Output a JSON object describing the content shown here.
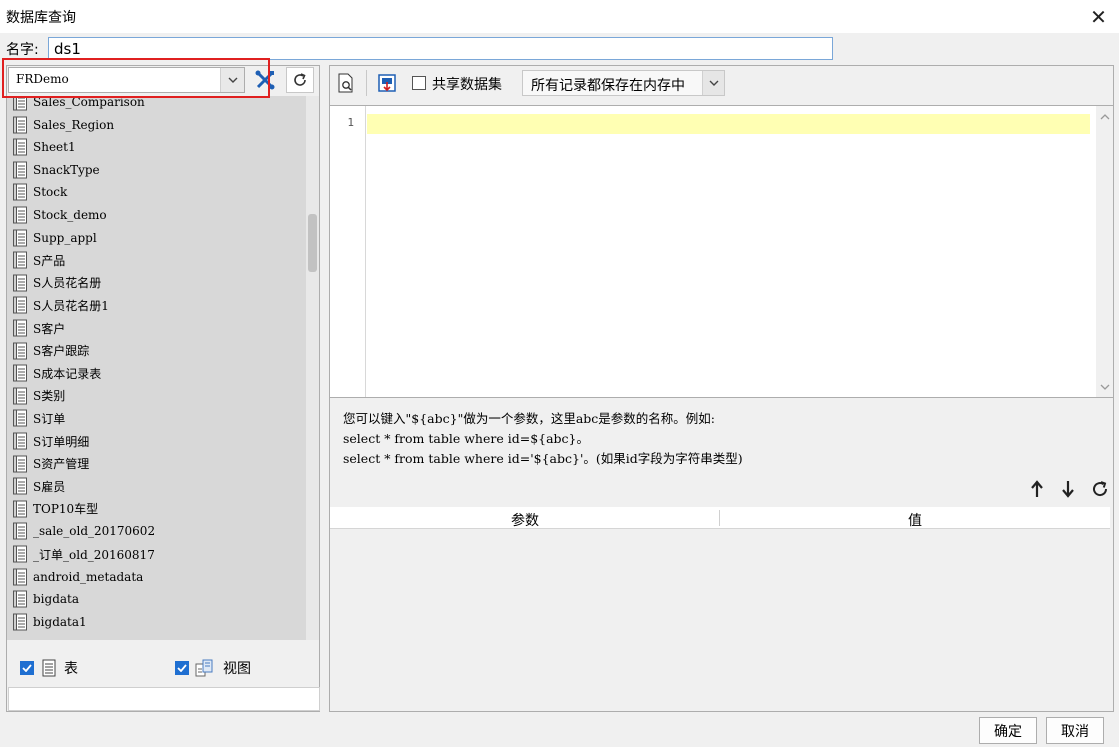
{
  "window": {
    "title": "数据库查询",
    "close_glyph": "✕"
  },
  "name_field": {
    "label": "名字:",
    "value": "ds1"
  },
  "datasource": {
    "selected": "FRDemo"
  },
  "table_list": {
    "items": [
      "Sales_Comparison",
      "Sales_Region",
      "Sheet1",
      "SnackType",
      "Stock",
      "Stock_demo",
      "Supp_appl",
      "S产品",
      "S人员花名册",
      "S人员花名册1",
      "S客户",
      "S客户跟踪",
      "S成本记录表",
      "S类别",
      "S订单",
      "S订单明细",
      "S资产管理",
      "S雇员",
      "TOP10车型",
      "_sale_old_20170602",
      "_订单_old_20160817",
      "android_metadata",
      "bigdata",
      "bigdata1"
    ]
  },
  "filters": {
    "table_label": "表",
    "view_label": "视图"
  },
  "toolbar": {
    "share_label": "共享数据集",
    "cache_option": "所有记录都保存在内存中"
  },
  "editor": {
    "line_number": "1"
  },
  "hint": {
    "line1": "您可以键入\"${abc}\"做为一个参数，这里abc是参数的名称。例如:",
    "line2": "select * from table where id=${abc}。",
    "line3": "select * from table where id='${abc}'。(如果id字段为字符串类型)"
  },
  "params": {
    "col_param": "参数",
    "col_value": "值"
  },
  "footer": {
    "ok": "确定",
    "cancel": "取消"
  },
  "colors": {
    "accent": "#1f6fd1",
    "highlight": "#e02020",
    "editor_line": "#ffffb3"
  }
}
